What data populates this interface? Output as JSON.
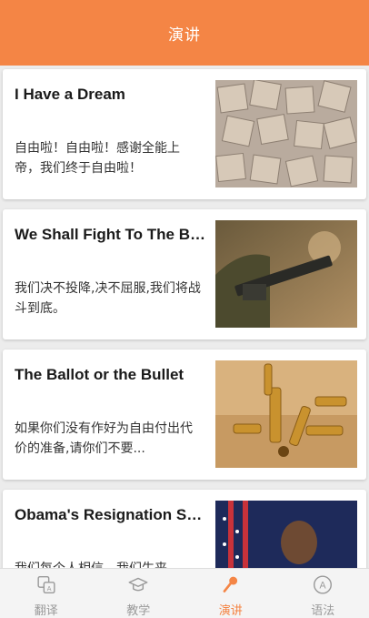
{
  "header": {
    "title": "演讲"
  },
  "speeches": [
    {
      "title": "I Have a Dream",
      "desc": "自由啦！自由啦！感谢全能上帝，我们终于自由啦！"
    },
    {
      "title": "We Shall Fight To The Beaches",
      "desc": "我们决不投降,决不屈服,我们将战斗到底。"
    },
    {
      "title": "The Ballot or the Bullet",
      "desc": "如果你们没有作好为自由付出代价的准备,请你们不要..."
    },
    {
      "title": "Obama's Resignation Speech",
      "desc": "我们每个人相信，我们生来"
    }
  ],
  "tabs": [
    {
      "label": "翻译",
      "icon": "translate-icon"
    },
    {
      "label": "教学",
      "icon": "graduation-cap-icon"
    },
    {
      "label": "演讲",
      "icon": "microphone-icon"
    },
    {
      "label": "语法",
      "icon": "grammar-icon"
    }
  ],
  "colors": {
    "accent": "#f48545",
    "tab_inactive": "#9a9a9a"
  }
}
